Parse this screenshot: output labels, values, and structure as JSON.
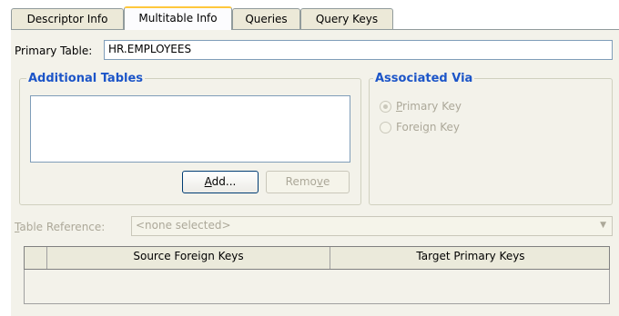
{
  "tabs": [
    {
      "label": "Descriptor Info",
      "active": false
    },
    {
      "label": "Multitable Info",
      "active": true
    },
    {
      "label": "Queries",
      "active": false
    },
    {
      "label": "Query Keys",
      "active": false
    }
  ],
  "primary_table": {
    "label": "Primary Table:",
    "value": "HR.EMPLOYEES"
  },
  "additional_tables": {
    "title": "Additional Tables",
    "add_button": {
      "pre": "",
      "mnemonic": "A",
      "post": "dd..."
    },
    "remove_button": {
      "pre": "Remo",
      "mnemonic": "v",
      "post": "e"
    }
  },
  "associated_via": {
    "title": "Associated Via",
    "options": [
      {
        "pre": "",
        "mnemonic": "P",
        "post": "rimary Key",
        "checked": true
      },
      {
        "pre": "Forei",
        "mnemonic": "g",
        "post": "n Key",
        "checked": false
      }
    ]
  },
  "table_reference": {
    "label_mnemonic": "T",
    "label_rest": "able Reference:",
    "value": "<none selected>"
  },
  "keys_table": {
    "columns": [
      "Source Foreign Keys",
      "Target Primary Keys"
    ],
    "rows": []
  },
  "colors": {
    "group_title": "#1c55c8",
    "tab_highlight": "#ffc83c",
    "panel_bg": "#f3f2ea"
  }
}
